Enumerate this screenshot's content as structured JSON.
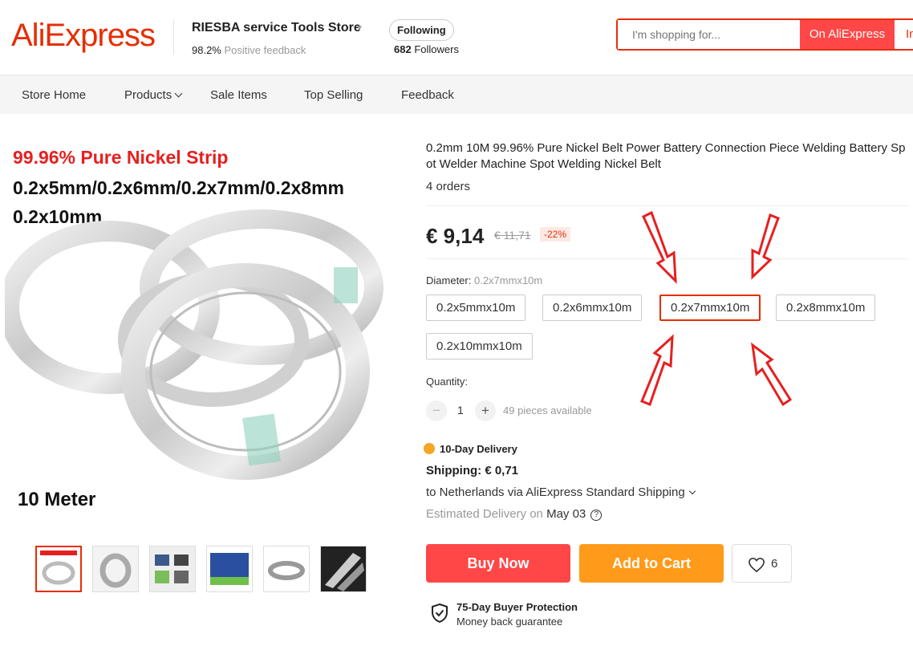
{
  "header": {
    "logo": "AliExpress",
    "store_name": "RIESBA service Tools Store",
    "feedback_pct": "98.2%",
    "feedback_label": "Positive feedback",
    "follow_label": "Following",
    "followers_count": "682",
    "followers_label": "Followers",
    "search_placeholder": "I'm shopping for...",
    "search_on": "On AliExpress",
    "search_in": "In"
  },
  "nav": {
    "items": [
      "Store Home",
      "Products",
      "Sale Items",
      "Top Selling",
      "Feedback"
    ]
  },
  "image": {
    "title_red": "99.96% Pure Nickel Strip",
    "title_black": "0.2x5mm/0.2x6mm/0.2x7mm/0.2x8mm 0.2x10mm",
    "bottom_label": "10 Meter"
  },
  "product": {
    "title": "0.2mm 10M 99.96% Pure Nickel Belt Power Battery Connection Piece Welding Battery Spot Welder Machine Spot Welding Nickel Belt",
    "orders": "4 orders",
    "price": "€ 9,14",
    "old_price": "€ 11,71",
    "discount": "-22%",
    "diameter_label": "Diameter:",
    "diameter_selected": "0.2x7mmx10m",
    "sku_options": [
      "0.2x5mmx10m",
      "0.2x6mmx10m",
      "0.2x7mmx10m",
      "0.2x8mmx10m",
      "0.2x10mmx10m"
    ],
    "quantity_label": "Quantity:",
    "quantity_minus": "−",
    "quantity_plus": "+",
    "quantity": "1",
    "available": "49 pieces available",
    "delivery_badge": "10-Day Delivery",
    "shipping": "Shipping: € 0,71",
    "ship_to": "to Netherlands via AliExpress Standard Shipping",
    "est_label": "Estimated Delivery on",
    "est_date": "May 03",
    "help_glyph": "?",
    "buy_now": "Buy Now",
    "add_to_cart": "Add to Cart",
    "wish_count": "6",
    "protection_title": "75-Day Buyer Protection",
    "protection_sub": "Money back guarantee"
  },
  "colors": {
    "brand": "#e62e04",
    "buy": "#ff4747",
    "cart": "#ff9a1a"
  }
}
